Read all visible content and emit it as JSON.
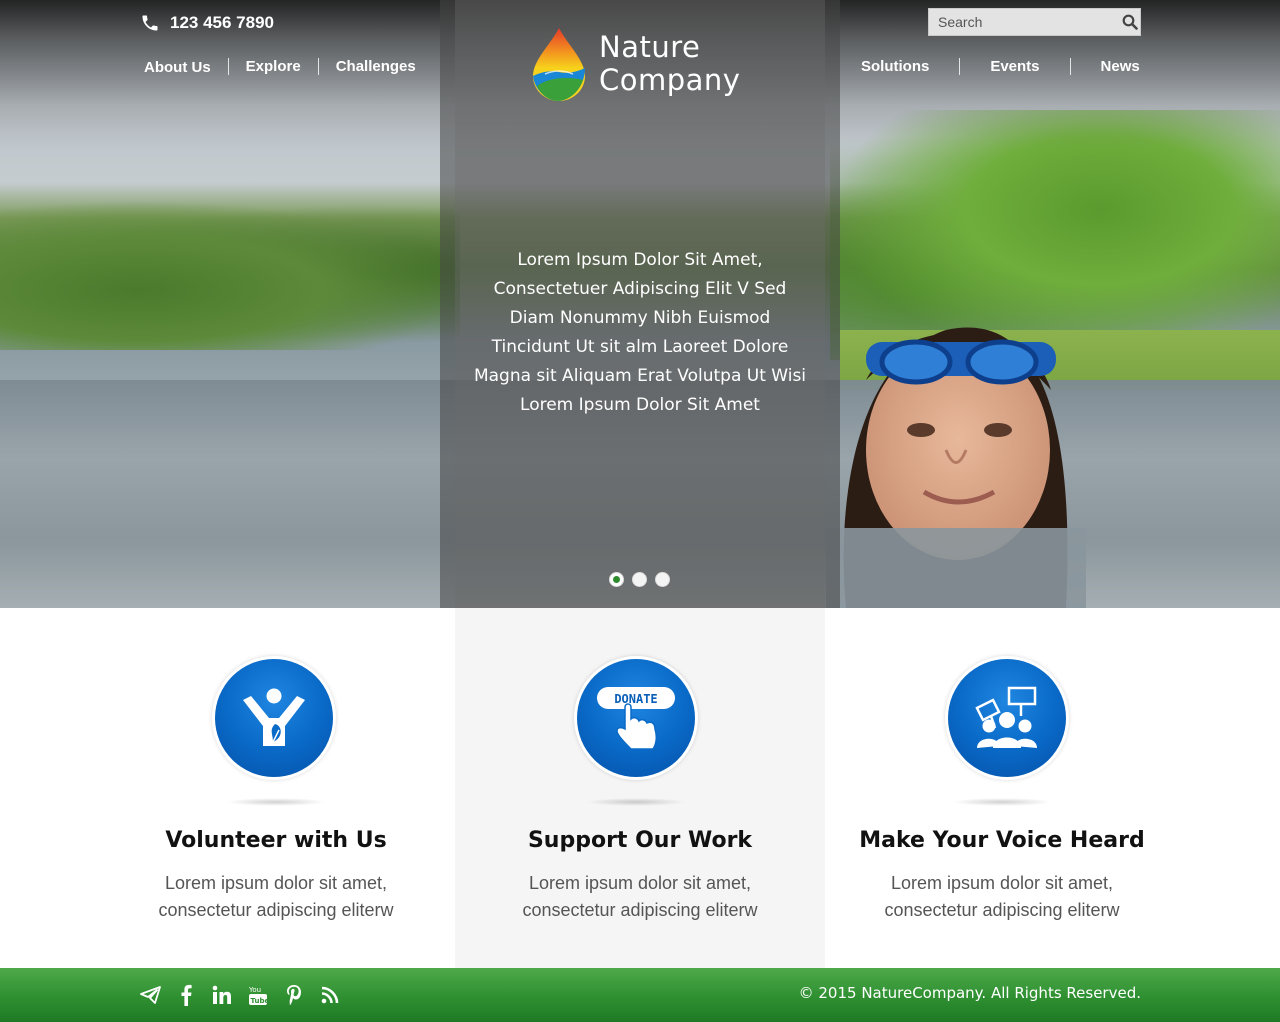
{
  "header": {
    "phone": "123 456 7890",
    "nav_left": [
      "About Us",
      "Explore",
      "Challenges"
    ],
    "nav_right": [
      "Solutions",
      "Events",
      "News"
    ],
    "search": {
      "placeholder": "Search"
    },
    "logo": {
      "line1": "Nature",
      "line2": "Company"
    }
  },
  "hero": {
    "copy": "Lorem Ipsum Dolor Sit Amet, Consectetuer Adipiscing Elit V Sed Diam Nonummy Nibh Euismod Tincidunt Ut sit alm Laoreet Dolore Magna sit Aliquam Erat Volutpa Ut Wisi Lorem Ipsum Dolor Sit Amet",
    "slides_total": 3,
    "active_slide": 1
  },
  "features": [
    {
      "icon": "volunteer-icon",
      "title": "Volunteer with Us",
      "desc_line1": "Lorem ipsum dolor sit amet,",
      "desc_line2": "consectetur adipiscing eliterw"
    },
    {
      "icon": "donate-icon",
      "title": "Support Our Work",
      "desc_line1": "Lorem ipsum dolor sit amet,",
      "desc_line2": "consectetur adipiscing eliterw",
      "icon_label": "DONATE"
    },
    {
      "icon": "protest-group-icon",
      "title": "Make Your Voice Heard",
      "desc_line1": "Lorem ipsum dolor sit amet,",
      "desc_line2": "consectetur adipiscing eliterw"
    }
  ],
  "footer": {
    "social": [
      "send-icon",
      "facebook-icon",
      "linkedin-icon",
      "youtube-icon",
      "pinterest-icon",
      "rss-icon"
    ],
    "copyright": "© 2015 NatureCompany. All Rights Reserved."
  },
  "colors": {
    "accent_green": "#2e8f30",
    "icon_blue": "#0a6ac8"
  }
}
